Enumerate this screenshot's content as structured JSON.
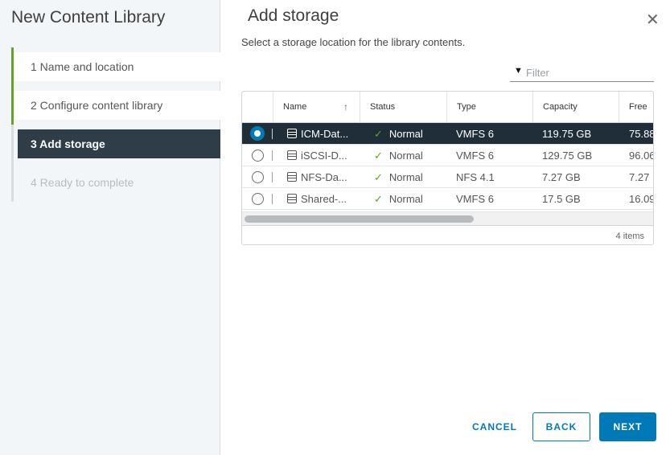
{
  "wizard": {
    "title": "New Content Library",
    "steps": [
      {
        "label": "1  Name and location",
        "state": "done"
      },
      {
        "label": "2  Configure content library",
        "state": "done"
      },
      {
        "label": "3  Add storage",
        "state": "current"
      },
      {
        "label": "4  Ready to complete",
        "state": "disabled"
      }
    ]
  },
  "page": {
    "title": "Add storage",
    "close_icon": "close-icon",
    "subtitle": "Select a storage location for the library contents."
  },
  "filter": {
    "placeholder": "Filter",
    "icon": "filter-icon"
  },
  "grid": {
    "columns": [
      "Name",
      "Status",
      "Type",
      "Capacity",
      "Free"
    ],
    "sort_icon": "arrow-up-icon",
    "rows": [
      {
        "name": "ICM-Dat...",
        "status": "Normal",
        "type": "VMFS 6",
        "capacity": "119.75 GB",
        "free": "75.88",
        "selected": true
      },
      {
        "name": "iSCSI-D...",
        "status": "Normal",
        "type": "VMFS 6",
        "capacity": "129.75 GB",
        "free": "96.06",
        "selected": false
      },
      {
        "name": "NFS-Da...",
        "status": "Normal",
        "type": "NFS 4.1",
        "capacity": "7.27 GB",
        "free": "7.27",
        "selected": false
      },
      {
        "name": "Shared-...",
        "status": "Normal",
        "type": "VMFS 6",
        "capacity": "17.5 GB",
        "free": "16.09",
        "selected": false
      }
    ],
    "footer": "4 items",
    "accent": "#0079b8",
    "status_color": "#62a420"
  },
  "buttons": {
    "cancel": "CANCEL",
    "back": "BACK",
    "next": "NEXT"
  }
}
